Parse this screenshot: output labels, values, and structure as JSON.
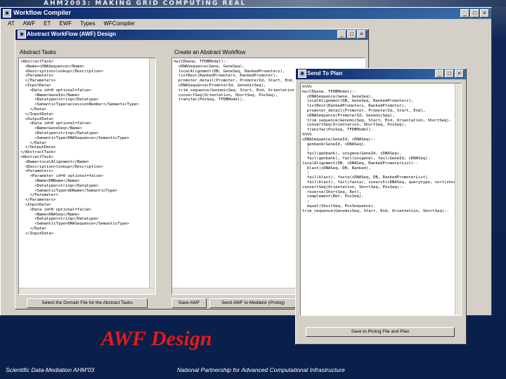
{
  "slide": {
    "header_title": "AHM2003: MAKING GRID COMPUTING REAL",
    "caption": "AWF Design",
    "footer_left": "Scientific Data-Mediation AHM'03",
    "footer_right": "National Partnership for Advanced Computational Infrastructure"
  },
  "main_window": {
    "title": "Workflow Compiler",
    "menu": [
      "AT",
      "AWF",
      "ET",
      "EWF",
      "Types",
      "WFCompiler"
    ],
    "buttons": {
      "minimize": "_",
      "maximize": "□",
      "close": "×"
    }
  },
  "awf_window": {
    "title": "Abstract WorkFlow (AWF) Design",
    "left_label": "Abstract Tasks",
    "right_label": "Create an Abstract Workflow",
    "left_lines": [
      "<AbstractTask>",
      "  <Name>cDNASequence</Name>",
      "  <Description>lookup</Description>",
      "  <Parameters>",
      "  </Parameters>",
      "  <InputData>",
      "    <Data id=0 optional=false>",
      "      <Name>GeneId</Name>",
      "      <Datatype>string</Datatype>",
      "      <SemanticType>accessionNumber</SemanticType>",
      "    </Data>",
      "  </InputData>",
      "  <OutputData>",
      "    <Data id=0 optional=false>",
      "      <Name>GeneSeq</Name>",
      "      <Datatype>string</Datatype>",
      "      <SemanticType>DNASequence</SemanticType>",
      "    </Data>",
      "  </OutputData>",
      "</AbstractTask>",
      "<AbstractTask>",
      "  <Name>localAlignment</Name>",
      "  <Description>lookup</Description>",
      "  <Parameters>",
      "    <Parameter id=0 optional=false>",
      "      <Name>DBName</Name>",
      "      <Datatype>string</Datatype>",
      "      <SemanticType>dbName</SemanticType>",
      "    </Parameter>",
      "  </Parameters>",
      "  <InputData>",
      "    <Data id=0 optional=false>",
      "      <Name>DNASeq</Name>",
      "      <Datatype>string</Datatype>",
      "      <SemanticType>DNASequence</SemanticType>",
      "    </Data>",
      "  </InputData>"
    ],
    "right_lines": [
      "hw(CDGene, TFDBModel):-",
      "  cDNASequence(Gene, GeneSeq),",
      "  localAlignment(DB, GeneSeq, RankedPromoters),",
      "  listRest(RankedPromoters, RankedPromoter),",
      "  promoter_detail(Promoter, PromoterId, Start, End,",
      "  cDNASequence(PromoterId, GenomicSeq),",
      "  trim_sequence(GenomicSeq, Start, End, Orientation",
      "  convertSeq(Orientation, ShortSeq, PosSeq),",
      "  transfac(PosSeq, TFDBModel)."
    ],
    "btn_select": "Select the Domain File for the Abstract Tasks",
    "btn_save": "Save AWF",
    "btn_send": "Send AWF to Mediator (Prolog)"
  },
  "send_window": {
    "title": "Send To Plan",
    "lines": [
      "%%%%",
      "",
      "hw(CDGene, TFDBModel):-",
      "  cDNASequence(Gene, GeneSeq),",
      "  localAlignment(DB, GeneSeq, RankedPromoters),",
      "  listRest(RankedPromoters, RankedPromoter),",
      "  promoter_detail(Promoter, PromoterId, Start, End),",
      "  cDNASequence(PromoterId, GenomicSeq),",
      "  trim_sequence(GenomicSeq, Start, End, Orientation, ShortSeq),",
      "  convertSeq(Orientation, ShortSeq, PosSeq),",
      "  transfac(PosSeq, TFDBModel).",
      "",
      "%%%%",
      "",
      "cDNASequence(GeneId, cDNASeq):-",
      "  genbank(GeneId, cDNASeq).",
      "  ;",
      "  fail(genbank), unigene(GeneId, cDNASeq).",
      "",
      "  fail(genbank), fail(unigene), fail(GeneId, cDNASeq).",
      "",
      "localAlignment(DB, cDNASeq, RankedPromoterList):-",
      "  blast(cDNASeq, DB, Ranked),",
      "  ;",
      "  fail(blast), fasta(cDNASeq, DB, RankedPromoterList).",
      "",
      "  fail(blast), fail(fasta), ssearch(cDNASeq, querytype, sort(shortseq)).",
      "",
      "convertSeq(Orientation, ShortSeq, PosSeq):-",
      "  reverse(ShortSeq, Ret),",
      "  complement(Ret, PosSeq).",
      "  ;",
      "  equal(ShortSeq, PosSequence).",
      "",
      "trim_sequence(GenomicSeq, Start, End, Orientation, ShortSeq):-"
    ],
    "btn_save": "Save to Prolog File and Plan"
  }
}
